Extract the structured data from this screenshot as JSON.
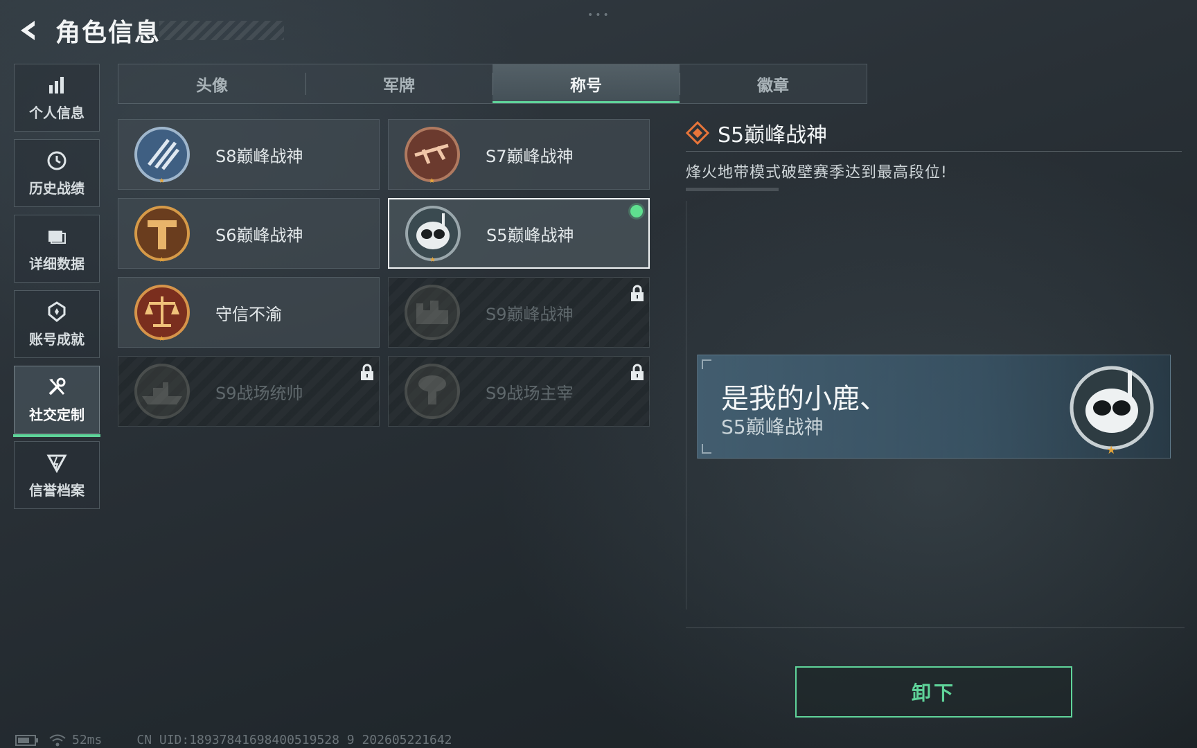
{
  "header": {
    "title": "角色信息"
  },
  "sidebar": {
    "items": [
      {
        "label": "个人信息",
        "icon": "bar-chart-icon"
      },
      {
        "label": "历史战绩",
        "icon": "clock-icon"
      },
      {
        "label": "详细数据",
        "icon": "folder-icon"
      },
      {
        "label": "账号成就",
        "icon": "achievement-icon"
      },
      {
        "label": "社交定制",
        "icon": "tools-icon",
        "active": true
      },
      {
        "label": "信誉档案",
        "icon": "shield-icon"
      }
    ]
  },
  "tabs": [
    {
      "label": "头像"
    },
    {
      "label": "军牌"
    },
    {
      "label": "称号",
      "active": true
    },
    {
      "label": "徽章"
    }
  ],
  "titles": [
    {
      "label": "S8巅峰战神",
      "badge": "blue-slash-badge-icon",
      "locked": false
    },
    {
      "label": "S7巅峰战神",
      "badge": "crossbow-badge-icon",
      "locked": false
    },
    {
      "label": "S6巅峰战神",
      "badge": "gold-t-badge-icon",
      "locked": false
    },
    {
      "label": "S5巅峰战神",
      "badge": "skull-diver-badge-icon",
      "locked": false,
      "selected": true,
      "equipped": true
    },
    {
      "label": "守信不渝",
      "badge": "scales-badge-icon",
      "locked": false
    },
    {
      "label": "S9巅峰战神",
      "badge": "fortress-badge-icon",
      "locked": true
    },
    {
      "label": "S9战场统帅",
      "badge": "warship-badge-icon",
      "locked": true
    },
    {
      "label": "S9战场主宰",
      "badge": "mushroom-cloud-badge-icon",
      "locked": true
    }
  ],
  "detail": {
    "title": "S5巅峰战神",
    "description": "烽火地带模式破壁赛季达到最高段位!"
  },
  "preview": {
    "player_name": "是我的小鹿、",
    "title": "S5巅峰战神"
  },
  "actions": {
    "unequip_label": "卸下"
  },
  "status": {
    "ping": "52ms",
    "uid": "CN UID:18937841698400519528 9 202605221642"
  },
  "colors": {
    "accent_green": "#5fd49a",
    "equipped_dot": "#5fe08f"
  }
}
